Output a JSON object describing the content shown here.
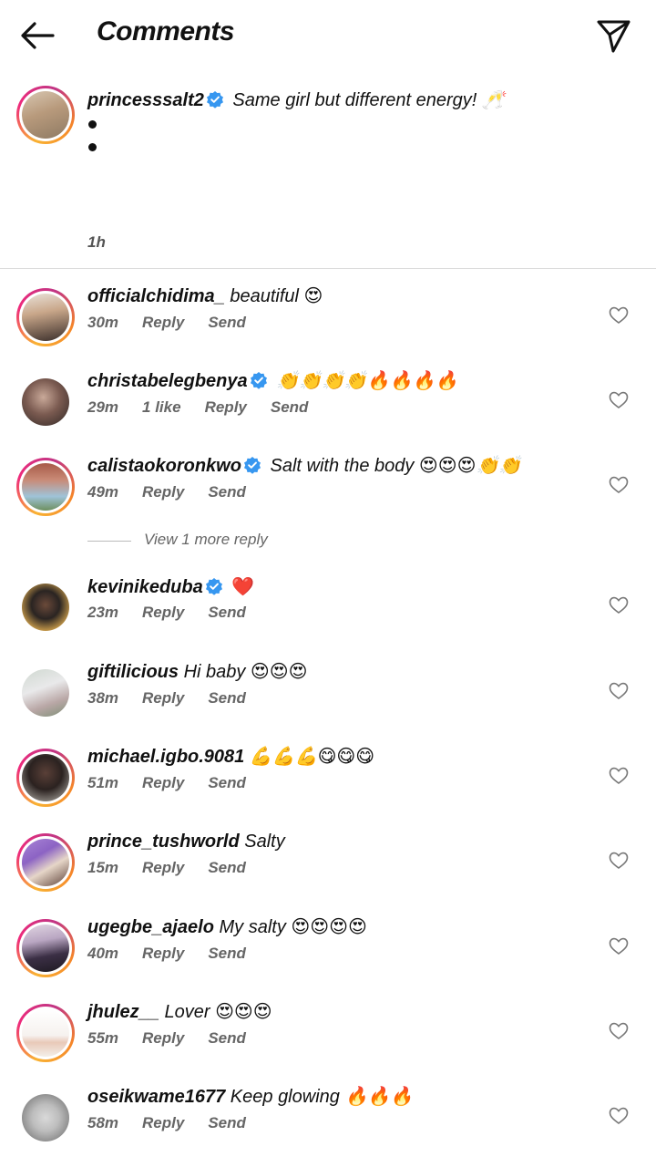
{
  "header": {
    "title": "Comments"
  },
  "caption": {
    "username": "princesssalt2",
    "text": "Same girl but different energy! 🥂",
    "time": "1h"
  },
  "view_more": "View 1 more reply",
  "actions": {
    "reply": "Reply",
    "send": "Send"
  },
  "comments": [
    {
      "username": "officialchidima_",
      "verified": false,
      "text": "beautiful 😍",
      "time": "30m",
      "likes": ""
    },
    {
      "username": "christabelegbenya",
      "verified": true,
      "text": "👏👏👏👏🔥🔥🔥🔥",
      "time": "29m",
      "likes": "1 like"
    },
    {
      "username": "calistaokoronkwo",
      "verified": true,
      "text": "Salt with the body 😍😍😍👏👏",
      "time": "49m",
      "likes": ""
    },
    {
      "username": "kevinikeduba",
      "verified": true,
      "text": "❤️",
      "time": "23m",
      "likes": ""
    },
    {
      "username": "giftilicious",
      "verified": false,
      "text": "Hi baby 😍😍😍",
      "time": "38m",
      "likes": ""
    },
    {
      "username": "michael.igbo.9081",
      "verified": false,
      "text": "💪💪💪😋😋😋",
      "time": "51m",
      "likes": ""
    },
    {
      "username": "prince_tushworld",
      "verified": false,
      "text": "Salty",
      "time": "15m",
      "likes": ""
    },
    {
      "username": "ugegbe_ajaelo",
      "verified": false,
      "text": "My salty 😍😍😍😍",
      "time": "40m",
      "likes": ""
    },
    {
      "username": "jhulez__",
      "verified": false,
      "text": "Lover 😍😍😍",
      "time": "55m",
      "likes": ""
    },
    {
      "username": "oseikwame1677",
      "verified": false,
      "text": "Keep glowing 🔥🔥🔥",
      "time": "58m",
      "likes": ""
    }
  ],
  "colors": {
    "verified": "#3797f0",
    "ring_start": "#f9b233",
    "ring_end": "#c13584",
    "meta": "#666666"
  }
}
